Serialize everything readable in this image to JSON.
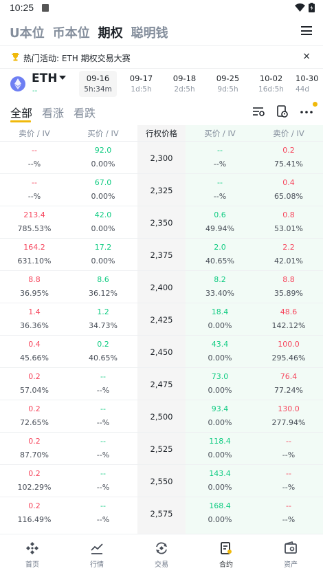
{
  "status": {
    "time": "10:25"
  },
  "top_nav": {
    "items": [
      {
        "label": "U本位",
        "active": false
      },
      {
        "label": "币本位",
        "active": false
      },
      {
        "label": "期权",
        "active": true
      },
      {
        "label": "聪明钱",
        "active": false
      }
    ]
  },
  "promo": {
    "text": "热门活动: ETH 期权交易大赛",
    "close": "×"
  },
  "asset": {
    "name": "ETH",
    "sub": "--"
  },
  "expiries": [
    {
      "date": "09-16",
      "countdown": "5h:34m",
      "active": true
    },
    {
      "date": "09-17",
      "countdown": "1d:5h",
      "active": false
    },
    {
      "date": "09-18",
      "countdown": "2d:5h",
      "active": false
    },
    {
      "date": "09-25",
      "countdown": "9d:5h",
      "active": false
    },
    {
      "date": "10-02",
      "countdown": "16d:5h",
      "active": false
    },
    {
      "date": "10-30",
      "countdown": "44d",
      "active": false
    }
  ],
  "filters": {
    "all": "全部",
    "bullish": "看涨",
    "bearish": "看跌"
  },
  "table": {
    "headers": {
      "call_ask": "卖价 / IV",
      "call_bid": "买价 / IV",
      "strike": "行权价格",
      "put_bid": "买价 / IV",
      "put_ask": "卖价 / IV"
    },
    "rows": [
      {
        "strike": "2,300",
        "call_ask": "--",
        "call_ask_iv": "--%",
        "call_bid": "92.0",
        "call_bid_iv": "0.00%",
        "put_bid": "--",
        "put_bid_iv": "--%",
        "put_ask": "0.2",
        "put_ask_iv": "75.41%"
      },
      {
        "strike": "2,325",
        "call_ask": "--",
        "call_ask_iv": "--%",
        "call_bid": "67.0",
        "call_bid_iv": "0.00%",
        "put_bid": "--",
        "put_bid_iv": "--%",
        "put_ask": "0.4",
        "put_ask_iv": "65.08%"
      },
      {
        "strike": "2,350",
        "call_ask": "213.4",
        "call_ask_iv": "785.53%",
        "call_bid": "42.0",
        "call_bid_iv": "0.00%",
        "put_bid": "0.6",
        "put_bid_iv": "49.94%",
        "put_ask": "0.8",
        "put_ask_iv": "53.01%"
      },
      {
        "strike": "2,375",
        "call_ask": "164.2",
        "call_ask_iv": "631.10%",
        "call_bid": "17.2",
        "call_bid_iv": "0.00%",
        "put_bid": "2.0",
        "put_bid_iv": "40.65%",
        "put_ask": "2.2",
        "put_ask_iv": "42.01%"
      },
      {
        "strike": "2,400",
        "call_ask": "8.8",
        "call_ask_iv": "36.95%",
        "call_bid": "8.6",
        "call_bid_iv": "36.12%",
        "put_bid": "8.2",
        "put_bid_iv": "33.40%",
        "put_ask": "8.8",
        "put_ask_iv": "35.89%"
      },
      {
        "strike": "2,425",
        "call_ask": "1.4",
        "call_ask_iv": "36.36%",
        "call_bid": "1.2",
        "call_bid_iv": "34.73%",
        "put_bid": "18.4",
        "put_bid_iv": "0.00%",
        "put_ask": "48.6",
        "put_ask_iv": "142.12%"
      },
      {
        "strike": "2,450",
        "call_ask": "0.4",
        "call_ask_iv": "45.66%",
        "call_bid": "0.2",
        "call_bid_iv": "40.65%",
        "put_bid": "43.4",
        "put_bid_iv": "0.00%",
        "put_ask": "100.0",
        "put_ask_iv": "295.46%"
      },
      {
        "strike": "2,475",
        "call_ask": "0.2",
        "call_ask_iv": "57.04%",
        "call_bid": "--",
        "call_bid_iv": "--%",
        "put_bid": "73.0",
        "put_bid_iv": "0.00%",
        "put_ask": "76.4",
        "put_ask_iv": "77.24%"
      },
      {
        "strike": "2,500",
        "call_ask": "0.2",
        "call_ask_iv": "72.65%",
        "call_bid": "--",
        "call_bid_iv": "--%",
        "put_bid": "93.4",
        "put_bid_iv": "0.00%",
        "put_ask": "130.0",
        "put_ask_iv": "277.94%"
      },
      {
        "strike": "2,525",
        "call_ask": "0.2",
        "call_ask_iv": "87.70%",
        "call_bid": "--",
        "call_bid_iv": "--%",
        "put_bid": "118.4",
        "put_bid_iv": "0.00%",
        "put_ask": "--",
        "put_ask_iv": "--%"
      },
      {
        "strike": "2,550",
        "call_ask": "0.2",
        "call_ask_iv": "102.29%",
        "call_bid": "--",
        "call_bid_iv": "--%",
        "put_bid": "143.4",
        "put_bid_iv": "0.00%",
        "put_ask": "--",
        "put_ask_iv": "--%"
      },
      {
        "strike": "2,575",
        "call_ask": "0.2",
        "call_ask_iv": "116.49%",
        "call_bid": "--",
        "call_bid_iv": "--%",
        "put_bid": "168.4",
        "put_bid_iv": "0.00%",
        "put_ask": "--",
        "put_ask_iv": "--%"
      }
    ]
  },
  "bottom_nav": [
    {
      "label": "首页",
      "icon": "home-icon",
      "active": false
    },
    {
      "label": "行情",
      "icon": "markets-icon",
      "active": false
    },
    {
      "label": "交易",
      "icon": "trade-icon",
      "active": false
    },
    {
      "label": "合约",
      "icon": "futures-icon",
      "active": true
    },
    {
      "label": "资产",
      "icon": "wallet-icon",
      "active": false
    }
  ],
  "colors": {
    "up": "#0ecb81",
    "down": "#f6465d",
    "accent": "#f0b90b"
  }
}
